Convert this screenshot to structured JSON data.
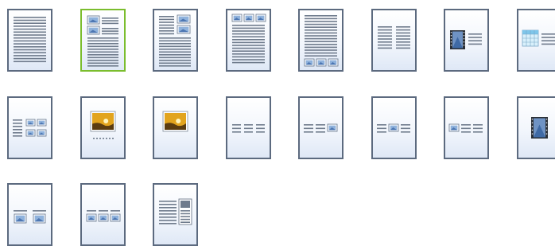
{
  "gallery": {
    "selected_index": 1,
    "accent_color": "#7bbd2e",
    "border_color": "#5c6a7f",
    "layouts": [
      {
        "id": "text-only"
      },
      {
        "id": "two-images-top-left-text"
      },
      {
        "id": "text-two-images-right"
      },
      {
        "id": "three-images-top-text"
      },
      {
        "id": "text-three-images-bottom"
      },
      {
        "id": "two-text-columns"
      },
      {
        "id": "video-left-text"
      },
      {
        "id": "table-left-text"
      },
      {
        "id": "text-four-images-right"
      },
      {
        "id": "single-image-caption-dots"
      },
      {
        "id": "single-image"
      },
      {
        "id": "three-short-columns"
      },
      {
        "id": "two-columns-image-right"
      },
      {
        "id": "column-image-column"
      },
      {
        "id": "image-two-columns"
      },
      {
        "id": "video-center"
      },
      {
        "id": "two-images-titled"
      },
      {
        "id": "three-images-titled"
      },
      {
        "id": "text-with-sidebar"
      }
    ]
  }
}
